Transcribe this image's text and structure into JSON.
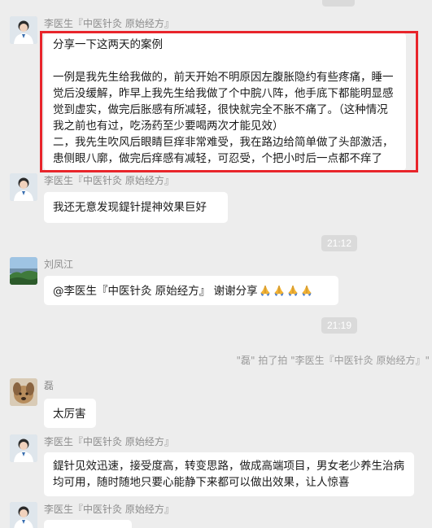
{
  "messages": [
    {
      "sender": "李医生『中医针灸 原始经方』",
      "avatar": "doctor-avatar",
      "paragraphs": [
        "分享一下这两天的案例",
        "",
        "一例是我先生给我做的，前天开始不明原因左腹胀隐约有些疼痛，睡一觉后没缓解，昨早上我先生给我做了个中脘八阵，他手底下都能明显感觉到虚实，做完后胀感有所减轻，很快就完全不胀不痛了。（这种情况我之前也有过，吃汤药至少要喝两次才能见效）",
        "二，我先生吹风后眼睛巨痒非常难受，我在路边给简单做了头部激活，患侧眼八廓，做完后痒感有减轻，可忍受，个把小时后一点都不痒了"
      ]
    },
    {
      "sender": "李医生『中医针灸 原始经方』",
      "avatar": "doctor-avatar",
      "text": "我还无意发现鍉针提神效果巨好"
    },
    {
      "time": "21:12"
    },
    {
      "sender": "刘凤江",
      "avatar": "landscape-avatar",
      "text": "@李医生『中医针灸 原始经方』 谢谢分享",
      "emoji": "folded-hands-icon",
      "emoji_count": 4
    },
    {
      "time": "21:19"
    },
    {
      "system": "\"磊\" 拍了拍 \"李医生『中医针灸 原始经方』\""
    },
    {
      "sender": "磊",
      "avatar": "dog-avatar",
      "text": "太厉害"
    },
    {
      "sender": "李医生『中医针灸 原始经方』",
      "avatar": "doctor-avatar",
      "text": "鍉针见效迅速，接受度高，转变思路，做成高端项目，男女老少养生治病均可用，随时随地只要心能静下来都可以做出效果，让人惊喜"
    },
    {
      "sender": "李医生『中医针灸 原始经方』",
      "avatar": "doctor-avatar"
    }
  ],
  "colors": {
    "background": "#ededed",
    "bubble": "#ffffff",
    "highlight": "#e8252b",
    "time_pill": "#dadada",
    "sender": "#8c8c8c"
  }
}
